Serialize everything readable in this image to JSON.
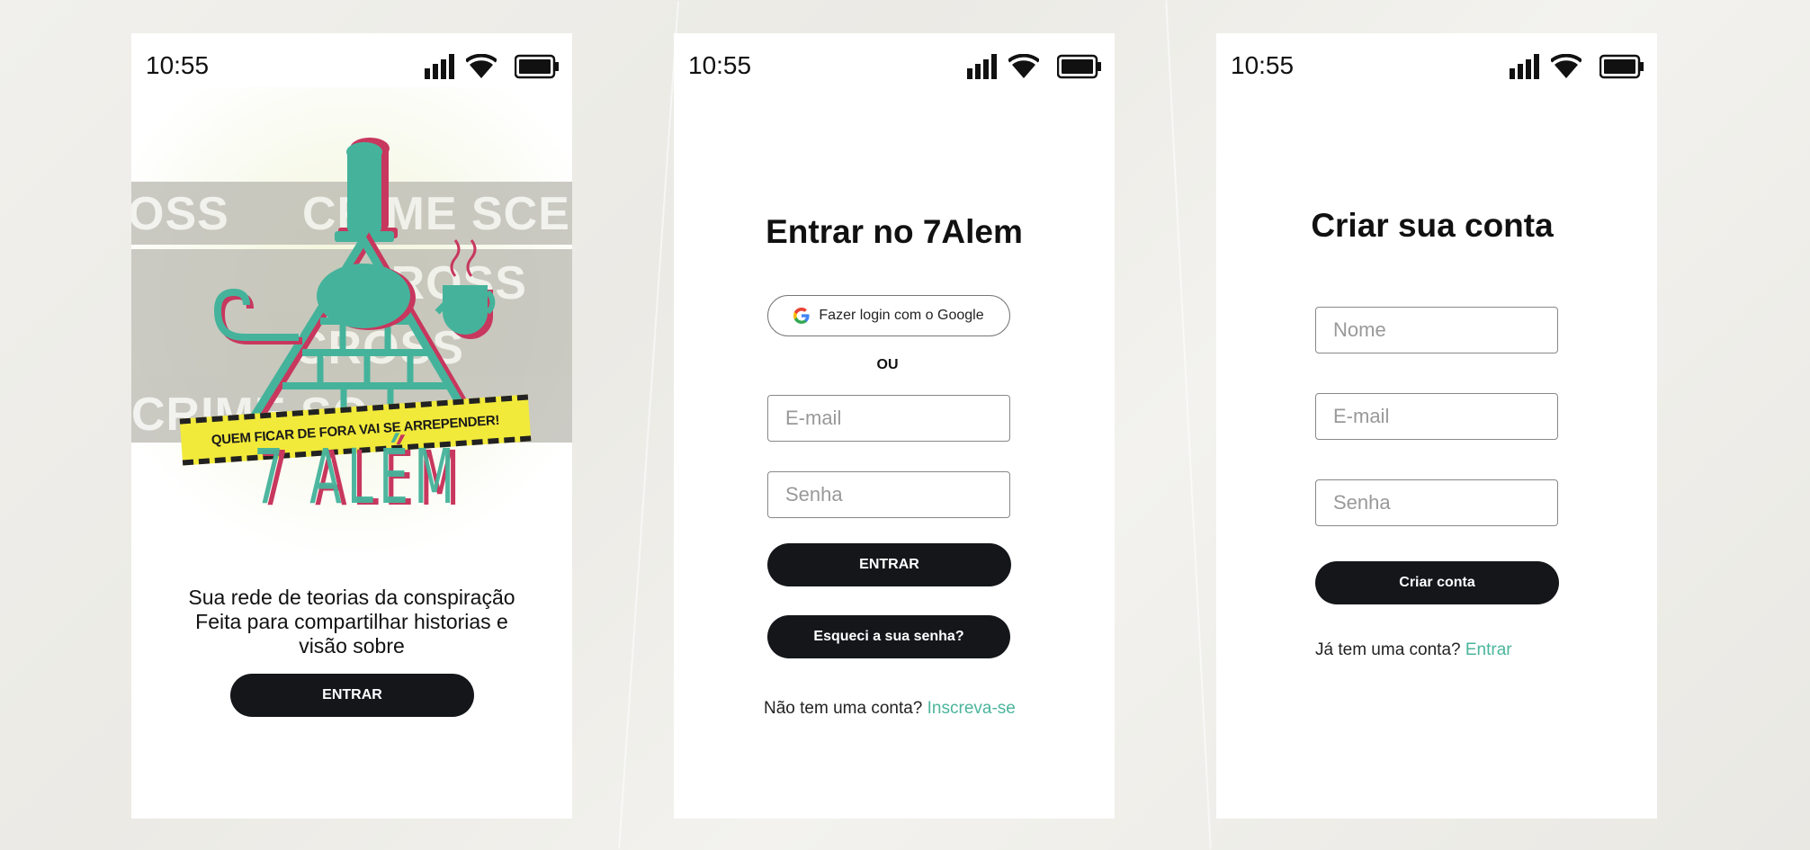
{
  "status": {
    "time": "10:55"
  },
  "screen1": {
    "tape_texts": [
      "OSS",
      "CRIME SCE",
      "CROSS",
      "CROSS",
      "CRIME SC"
    ],
    "banner_text": "QUEM FICAR DE FORA VAI SE ARREPENDER!",
    "logo_text": "7 ALÉM",
    "tagline": [
      "Sua rede de teorias  da conspiração",
      "Feita para compartilhar historias e",
      "visão sobre"
    ],
    "enter_button": "ENTRAR"
  },
  "screen2": {
    "title": "Entrar no 7Alem",
    "google_button": "Fazer login com o Google",
    "or_label": "OU",
    "email_placeholder": "E-mail",
    "password_placeholder": "Senha",
    "enter_button": "ENTRAR",
    "forgot_button": "Esqueci a sua senha?",
    "signup_prompt": "Não tem uma conta?",
    "signup_link": "Inscreva-se"
  },
  "screen3": {
    "title": "Criar sua conta",
    "name_placeholder": "Nome",
    "email_placeholder": "E-mail",
    "password_placeholder": "Senha",
    "create_button": "Criar conta",
    "login_prompt": "Já tem uma conta?",
    "login_link": "Entrar"
  },
  "colors": {
    "accent": "#4bb59c",
    "dark": "#14161a",
    "pink": "#c8375e",
    "teal": "#45b39b",
    "yellow": "#f2ea3a"
  }
}
